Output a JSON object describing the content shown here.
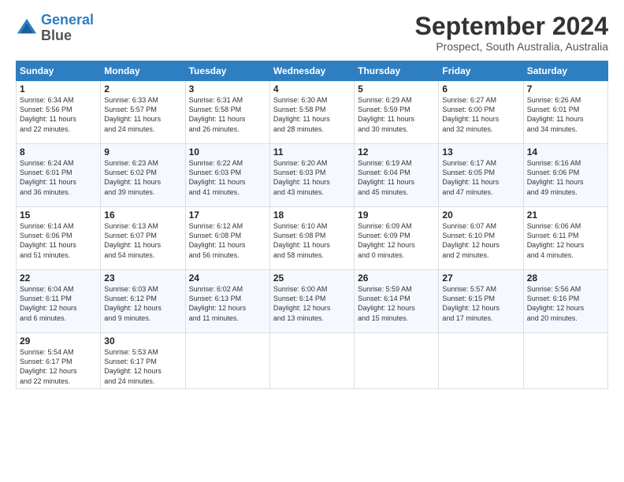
{
  "logo": {
    "line1": "General",
    "line2": "Blue"
  },
  "title": "September 2024",
  "subtitle": "Prospect, South Australia, Australia",
  "days_header": [
    "Sunday",
    "Monday",
    "Tuesday",
    "Wednesday",
    "Thursday",
    "Friday",
    "Saturday"
  ],
  "weeks": [
    [
      {
        "num": "1",
        "info": "Sunrise: 6:34 AM\nSunset: 5:56 PM\nDaylight: 11 hours\nand 22 minutes."
      },
      {
        "num": "2",
        "info": "Sunrise: 6:33 AM\nSunset: 5:57 PM\nDaylight: 11 hours\nand 24 minutes."
      },
      {
        "num": "3",
        "info": "Sunrise: 6:31 AM\nSunset: 5:58 PM\nDaylight: 11 hours\nand 26 minutes."
      },
      {
        "num": "4",
        "info": "Sunrise: 6:30 AM\nSunset: 5:58 PM\nDaylight: 11 hours\nand 28 minutes."
      },
      {
        "num": "5",
        "info": "Sunrise: 6:29 AM\nSunset: 5:59 PM\nDaylight: 11 hours\nand 30 minutes."
      },
      {
        "num": "6",
        "info": "Sunrise: 6:27 AM\nSunset: 6:00 PM\nDaylight: 11 hours\nand 32 minutes."
      },
      {
        "num": "7",
        "info": "Sunrise: 6:26 AM\nSunset: 6:01 PM\nDaylight: 11 hours\nand 34 minutes."
      }
    ],
    [
      {
        "num": "8",
        "info": "Sunrise: 6:24 AM\nSunset: 6:01 PM\nDaylight: 11 hours\nand 36 minutes."
      },
      {
        "num": "9",
        "info": "Sunrise: 6:23 AM\nSunset: 6:02 PM\nDaylight: 11 hours\nand 39 minutes."
      },
      {
        "num": "10",
        "info": "Sunrise: 6:22 AM\nSunset: 6:03 PM\nDaylight: 11 hours\nand 41 minutes."
      },
      {
        "num": "11",
        "info": "Sunrise: 6:20 AM\nSunset: 6:03 PM\nDaylight: 11 hours\nand 43 minutes."
      },
      {
        "num": "12",
        "info": "Sunrise: 6:19 AM\nSunset: 6:04 PM\nDaylight: 11 hours\nand 45 minutes."
      },
      {
        "num": "13",
        "info": "Sunrise: 6:17 AM\nSunset: 6:05 PM\nDaylight: 11 hours\nand 47 minutes."
      },
      {
        "num": "14",
        "info": "Sunrise: 6:16 AM\nSunset: 6:06 PM\nDaylight: 11 hours\nand 49 minutes."
      }
    ],
    [
      {
        "num": "15",
        "info": "Sunrise: 6:14 AM\nSunset: 6:06 PM\nDaylight: 11 hours\nand 51 minutes."
      },
      {
        "num": "16",
        "info": "Sunrise: 6:13 AM\nSunset: 6:07 PM\nDaylight: 11 hours\nand 54 minutes."
      },
      {
        "num": "17",
        "info": "Sunrise: 6:12 AM\nSunset: 6:08 PM\nDaylight: 11 hours\nand 56 minutes."
      },
      {
        "num": "18",
        "info": "Sunrise: 6:10 AM\nSunset: 6:08 PM\nDaylight: 11 hours\nand 58 minutes."
      },
      {
        "num": "19",
        "info": "Sunrise: 6:09 AM\nSunset: 6:09 PM\nDaylight: 12 hours\nand 0 minutes."
      },
      {
        "num": "20",
        "info": "Sunrise: 6:07 AM\nSunset: 6:10 PM\nDaylight: 12 hours\nand 2 minutes."
      },
      {
        "num": "21",
        "info": "Sunrise: 6:06 AM\nSunset: 6:11 PM\nDaylight: 12 hours\nand 4 minutes."
      }
    ],
    [
      {
        "num": "22",
        "info": "Sunrise: 6:04 AM\nSunset: 6:11 PM\nDaylight: 12 hours\nand 6 minutes."
      },
      {
        "num": "23",
        "info": "Sunrise: 6:03 AM\nSunset: 6:12 PM\nDaylight: 12 hours\nand 9 minutes."
      },
      {
        "num": "24",
        "info": "Sunrise: 6:02 AM\nSunset: 6:13 PM\nDaylight: 12 hours\nand 11 minutes."
      },
      {
        "num": "25",
        "info": "Sunrise: 6:00 AM\nSunset: 6:14 PM\nDaylight: 12 hours\nand 13 minutes."
      },
      {
        "num": "26",
        "info": "Sunrise: 5:59 AM\nSunset: 6:14 PM\nDaylight: 12 hours\nand 15 minutes."
      },
      {
        "num": "27",
        "info": "Sunrise: 5:57 AM\nSunset: 6:15 PM\nDaylight: 12 hours\nand 17 minutes."
      },
      {
        "num": "28",
        "info": "Sunrise: 5:56 AM\nSunset: 6:16 PM\nDaylight: 12 hours\nand 20 minutes."
      }
    ],
    [
      {
        "num": "29",
        "info": "Sunrise: 5:54 AM\nSunset: 6:17 PM\nDaylight: 12 hours\nand 22 minutes."
      },
      {
        "num": "30",
        "info": "Sunrise: 5:53 AM\nSunset: 6:17 PM\nDaylight: 12 hours\nand 24 minutes."
      },
      {
        "num": "",
        "info": ""
      },
      {
        "num": "",
        "info": ""
      },
      {
        "num": "",
        "info": ""
      },
      {
        "num": "",
        "info": ""
      },
      {
        "num": "",
        "info": ""
      }
    ]
  ]
}
